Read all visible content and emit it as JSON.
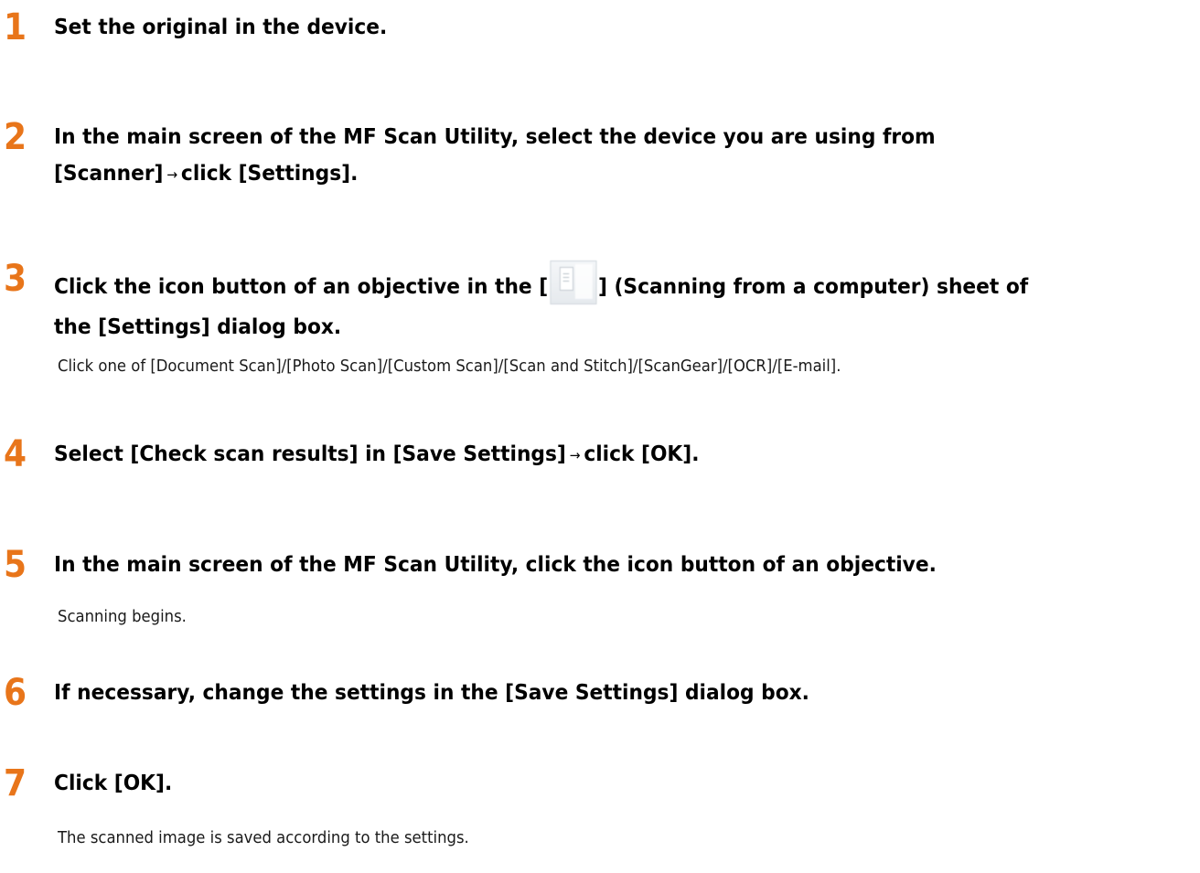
{
  "steps": [
    {
      "number": "1",
      "title_lines": [
        "Set the original in the device."
      ]
    },
    {
      "number": "2",
      "title_lines": [
        "In the main screen of the MF Scan Utility, select the device you are using from",
        "[Scanner]",
        "click [Settings]."
      ]
    },
    {
      "number": "3",
      "title_before_icon": "Click the icon button of an objective in the [",
      "title_after_icon": "] (Scanning from a computer) sheet of",
      "title_line2": "the [Settings] dialog box.",
      "note": "Click one of [Document Scan]/[Photo Scan]/[Custom Scan]/[Scan and Stitch]/[ScanGear]/[OCR]/[E-mail]."
    },
    {
      "number": "4",
      "title_part1": "Select [Check scan results] in [Save Settings]",
      "title_part2": "click [OK]."
    },
    {
      "number": "5",
      "title_lines": [
        "In the main screen of the MF Scan Utility, click the icon button of an objective."
      ],
      "note": "Scanning begins."
    },
    {
      "number": "6",
      "title_lines": [
        "If necessary, change the settings in the [Save Settings] dialog box."
      ]
    },
    {
      "number": "7",
      "title_lines": [
        "Click [OK]."
      ],
      "note": "The scanned image is saved according to the settings."
    }
  ],
  "arrow_symbol": "→",
  "icon_name": "scan-from-computer-sheet-icon",
  "colors": {
    "step_number": "#e8751a",
    "text": "#000000"
  }
}
